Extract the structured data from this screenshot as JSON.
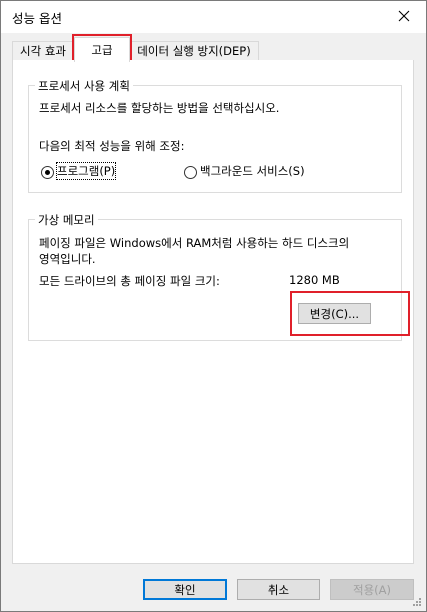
{
  "window": {
    "title": "성능 옵션"
  },
  "tabs": [
    {
      "label": "시각 효과",
      "active": false
    },
    {
      "label": "고급",
      "active": true
    },
    {
      "label": "데이터 실행 방지(DEP)",
      "active": false
    }
  ],
  "processor": {
    "group_title": "프로세서 사용 계획",
    "description": "프로세서 리소스를 할당하는 방법을 선택하십시오.",
    "adjust_label": "다음의 최적 성능을 위해 조정:",
    "options": [
      {
        "label": "프로그램(P)",
        "checked": true
      },
      {
        "label": "백그라운드 서비스(S)",
        "checked": false
      }
    ]
  },
  "virtual_memory": {
    "group_title": "가상 메모리",
    "description_line1": "페이징 파일은 Windows에서 RAM처럼 사용하는 하드 디스크의",
    "description_line2": "영역입니다.",
    "total_label": "모든 드라이브의 총 페이징 파일 크기:",
    "total_value": "1280 MB",
    "change_button": "변경(C)..."
  },
  "footer": {
    "ok": "확인",
    "cancel": "취소",
    "apply": "적용(A)"
  },
  "colors": {
    "highlight_red": "#e0202a",
    "default_button_border": "#0078d7"
  },
  "icons": {
    "close": "close-icon"
  }
}
